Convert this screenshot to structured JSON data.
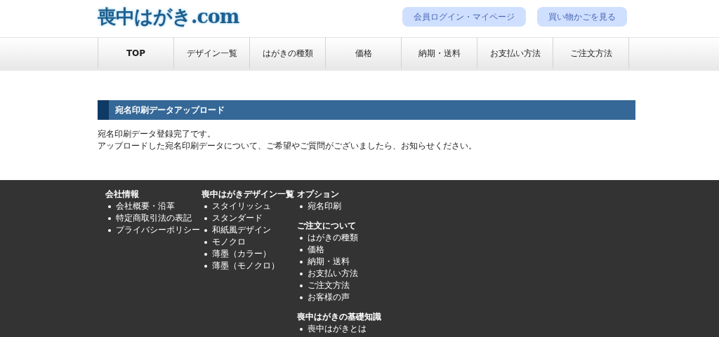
{
  "header": {
    "logo": "喪中はがき.com",
    "buttons": [
      "会員ログイン・マイページ",
      "買い物かごを見る"
    ]
  },
  "nav": [
    "TOP",
    "デザイン一覧",
    "はがきの種類",
    "価格",
    "納期・送料",
    "お支払い方法",
    "ご注文方法"
  ],
  "section": {
    "title": "宛名印刷データアップロード",
    "lines": [
      "宛名印刷データ登録完了です。",
      "アップロードした宛名印刷データについて、ご希望やご質問がございましたら、お知らせください。"
    ]
  },
  "footer": {
    "columns": [
      {
        "groups": [
          {
            "heading": "会社情報",
            "links": [
              "会社概要・沿革",
              "特定商取引法の表記",
              "プライバシーポリシー"
            ]
          }
        ]
      },
      {
        "groups": [
          {
            "heading": "喪中はがきデザイン一覧",
            "links": [
              "スタイリッシュ",
              "スタンダード",
              "和紙風デザイン",
              "モノクロ",
              "薄墨（カラー）",
              "薄墨（モノクロ）"
            ]
          }
        ]
      },
      {
        "groups": [
          {
            "heading": "オプション",
            "links": [
              "宛名印刷"
            ]
          },
          {
            "heading": "ご注文について",
            "links": [
              "はがきの種類",
              "価格",
              "納期・送料",
              "お支払い方法",
              "ご注文方法",
              "お客様の声"
            ]
          },
          {
            "heading": "喪中はがきの基礎知識",
            "links": [
              "喪中はがきとは"
            ]
          }
        ]
      }
    ]
  }
}
